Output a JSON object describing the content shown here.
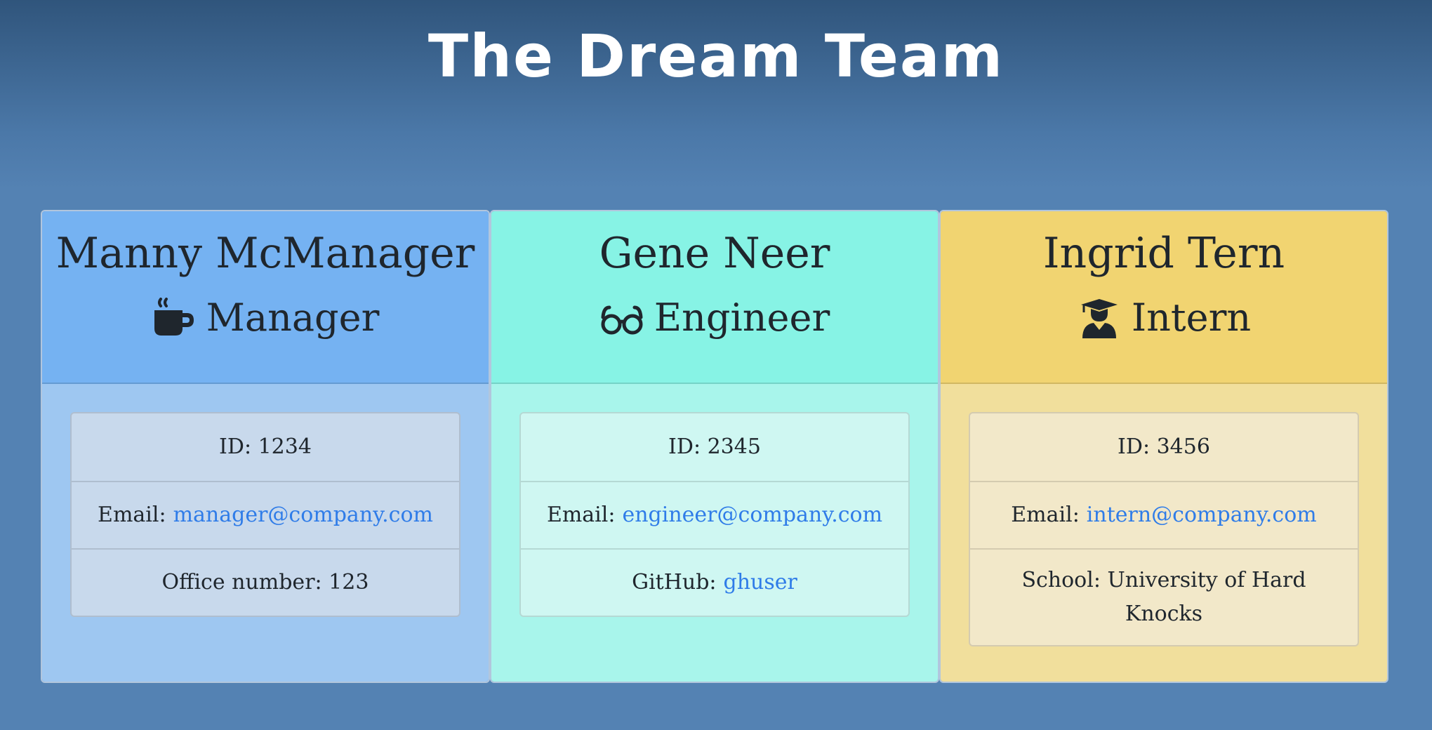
{
  "page": {
    "title": "The Dream Team"
  },
  "team": [
    {
      "name": "Manny McManager",
      "role": "Manager",
      "icon": "coffee-icon",
      "id_label": "ID: 1234",
      "email_label": "Email:",
      "email": "manager@company.com",
      "extra_label": "Office number: 123",
      "extra_link": ""
    },
    {
      "name": "Gene Neer",
      "role": "Engineer",
      "icon": "glasses-icon",
      "id_label": "ID: 2345",
      "email_label": "Email:",
      "email": "engineer@company.com",
      "extra_label": "GitHub:",
      "extra_link": "ghuser"
    },
    {
      "name": "Ingrid Tern",
      "role": "Intern",
      "icon": "graduate-icon",
      "id_label": "ID: 3456",
      "email_label": "Email:",
      "email": "intern@company.com",
      "extra_label": "School: University of Hard Knocks",
      "extra_link": ""
    }
  ],
  "colors": {
    "manager_header": "#75b2f2",
    "engineer_header": "#87f3e5",
    "intern_header": "#f1d471",
    "link": "#2f7ce8"
  }
}
